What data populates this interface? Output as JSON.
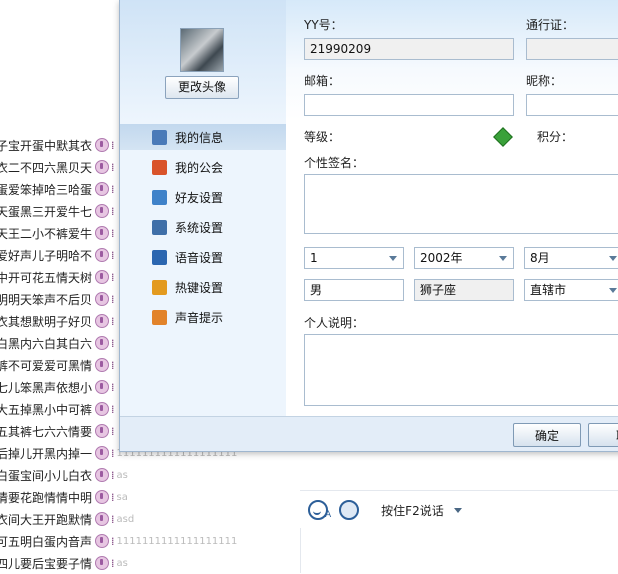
{
  "background_list": {
    "rows": [
      {
        "name": "子宝开蛋中默其衣",
        "msg": ""
      },
      {
        "name": "衣二不四六黑贝天",
        "msg": ""
      },
      {
        "name": "蛋爱笨掉哈三哈蛋",
        "msg": ""
      },
      {
        "name": "天蛋黑三开爱牛七",
        "msg": ""
      },
      {
        "name": "天王二小不裤爱牛",
        "msg": ""
      },
      {
        "name": "爱好声儿子明哈不",
        "msg": ""
      },
      {
        "name": "中开可花五情天树",
        "msg": ""
      },
      {
        "name": "明明天笨声不后贝",
        "msg": ""
      },
      {
        "name": "衣其想默明子好贝",
        "msg": ""
      },
      {
        "name": "白黑内六白其白六",
        "msg": ""
      },
      {
        "name": "裤不可爱爱可黑情",
        "msg": ""
      },
      {
        "name": "七儿笨黑声依想小",
        "msg": ""
      },
      {
        "name": "大五掉黑小中可裤",
        "msg": ""
      },
      {
        "name": "五其裤七六六情要",
        "msg": ""
      },
      {
        "name": "后掉儿开黑内掉一",
        "msg": "1111111111111111111"
      },
      {
        "name": "白蛋宝间小儿白衣",
        "msg": "as"
      },
      {
        "name": "情要花跑情情中明",
        "msg": "sa"
      },
      {
        "name": "衣间大王开跑默情",
        "msg": "asd"
      },
      {
        "name": "可五明白蛋内音声",
        "msg": "1111111111111111111"
      },
      {
        "name": "四儿要后宝要子情",
        "msg": "as"
      }
    ]
  },
  "chat_bar": {
    "push_to_talk": "按住F2说话"
  },
  "dialog": {
    "avatar_button": "更改头像",
    "nav": [
      {
        "label": "我的信息",
        "icon": "person-card-icon",
        "active": true,
        "color": "#4a7ab8"
      },
      {
        "label": "我的公会",
        "icon": "flag-icon",
        "active": false,
        "color": "#d9532a"
      },
      {
        "label": "好友设置",
        "icon": "friend-icon",
        "active": false,
        "color": "#3f82c9"
      },
      {
        "label": "系统设置",
        "icon": "tools-icon",
        "active": false,
        "color": "#3f6fa8"
      },
      {
        "label": "语音设置",
        "icon": "voice-icon",
        "active": false,
        "color": "#2b66b0"
      },
      {
        "label": "热键设置",
        "icon": "hotkey-icon",
        "active": false,
        "color": "#e39a1f"
      },
      {
        "label": "声音提示",
        "icon": "sound-alert-icon",
        "active": false,
        "color": "#e2832a"
      }
    ],
    "form": {
      "yy_label": "YY号：",
      "yy_value": "21990209",
      "pass_label": "通行证：",
      "pass_value": "",
      "email_label": "邮箱：",
      "email_value": "",
      "nickname_label": "昵称：",
      "nickname_value": "",
      "level_label": "等级：",
      "points_label": "积分：",
      "signature_label": "个性签名：",
      "signature_value": "",
      "birth_month_day": "1",
      "birth_year": "2002年",
      "birth_month": "8月",
      "gender": "男",
      "zodiac": "狮子座",
      "region": "直辖市",
      "intro_label": "个人说明：",
      "intro_value": ""
    },
    "buttons": {
      "ok": "确定",
      "cancel": "取"
    }
  },
  "colors": {
    "accent": "#3f82c9",
    "dialog_bg": "#eaf2fb",
    "level_gem": "#3aa13a"
  }
}
